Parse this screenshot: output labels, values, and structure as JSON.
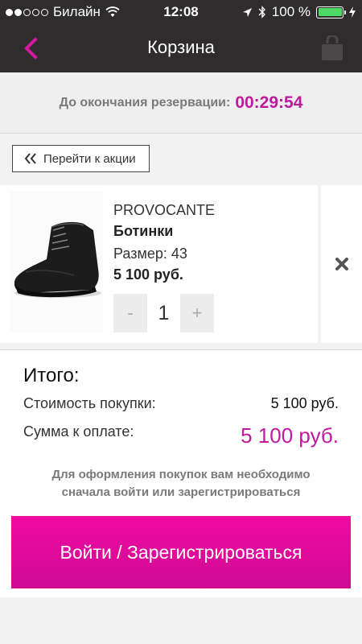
{
  "status_bar": {
    "carrier": "Билайн",
    "time": "12:08",
    "battery": "100 %",
    "signal_bars_filled": 2,
    "signal_bars_total": 5
  },
  "nav": {
    "title": "Корзина",
    "back_icon": "chevron-left-icon",
    "bag_icon": "shopping-bag-icon"
  },
  "reservation": {
    "label": "До окончания резервации:",
    "time": "00:29:54"
  },
  "promo": {
    "label": "Перейти к акции"
  },
  "product": {
    "brand": "PROVOCANTE",
    "name": "Ботинки",
    "size": "Размер: 43",
    "price": "5 100 руб.",
    "quantity": "1",
    "minus": "-",
    "plus": "+"
  },
  "totals": {
    "title": "Итого:",
    "cost_label": "Стоимость покупки:",
    "cost_value": "5 100 руб.",
    "pay_label": "Сумма к оплате:",
    "pay_value": "5 100 руб.",
    "note_line1": "Для оформления покупок вам необходимо",
    "note_line2": "сначала войти или зарегистрироваться"
  },
  "login_button": {
    "label": "Войти / Зарегистрироваться"
  },
  "colors": {
    "accent": "#c0189e",
    "button": "#e80b9c",
    "header": "#2e2c2d"
  }
}
